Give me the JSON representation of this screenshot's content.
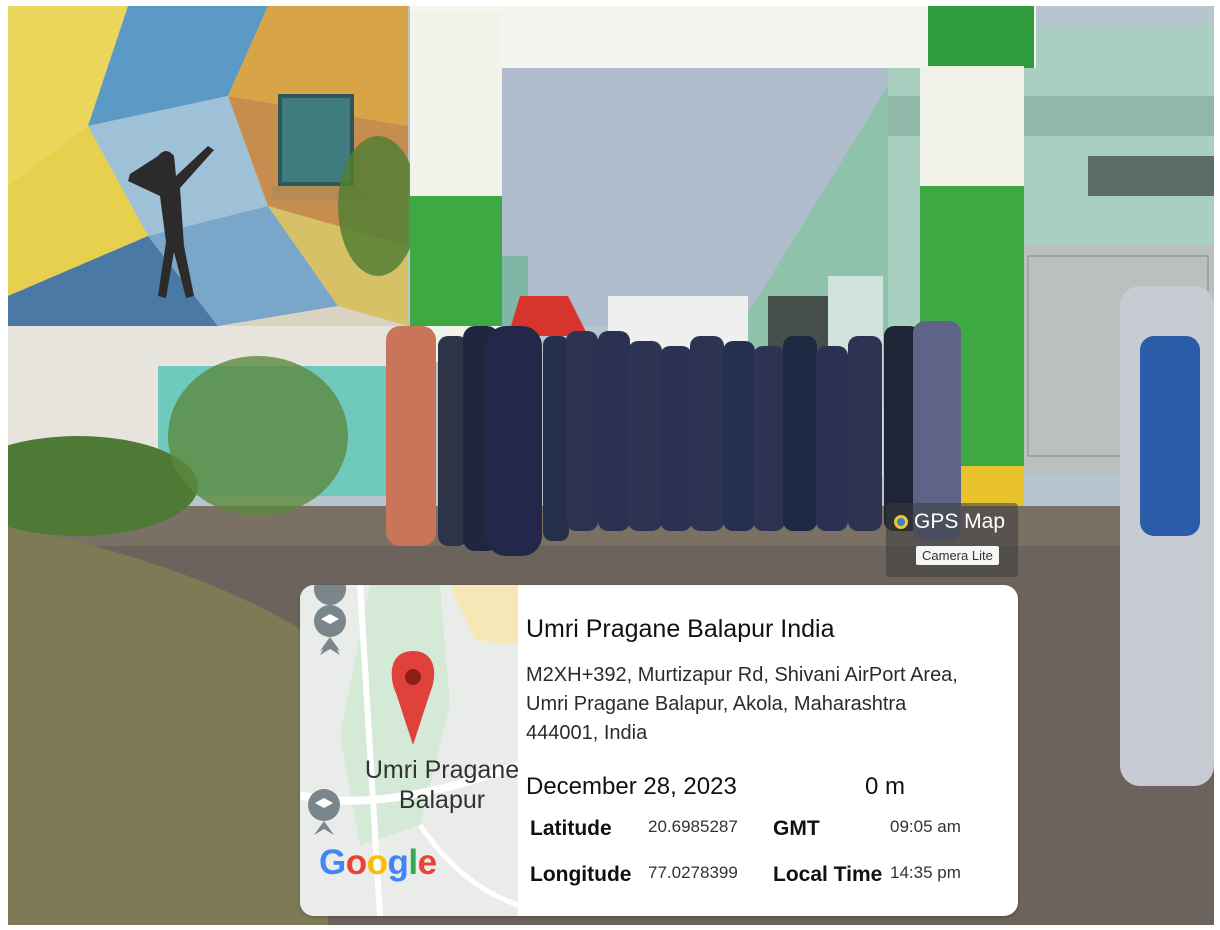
{
  "gps_badge": {
    "title": "GPS Map",
    "subtitle": "Camera Lite"
  },
  "location_card": {
    "place_name": "Umri Pragane Balapur India",
    "address_lines": [
      "M2XH+392, Murtizapur Rd, Shivani AirPort Area,",
      "Umri Pragane Balapur, Akola, Maharashtra",
      "444001, India"
    ],
    "date": "December 28, 2023",
    "altitude": "0 m",
    "latitude_label": "Latitude",
    "latitude_value": "20.6985287",
    "longitude_label": "Longitude",
    "longitude_value": "77.0278399",
    "gmt_label": "GMT",
    "gmt_value": "09:05 am",
    "local_time_label": "Local Time",
    "local_time_value": "14:35 pm"
  },
  "map": {
    "place_label_line1": "Umri Pragane",
    "place_label_line2": "Balapur",
    "provider": "Google",
    "pin_color": "#e0413a"
  }
}
